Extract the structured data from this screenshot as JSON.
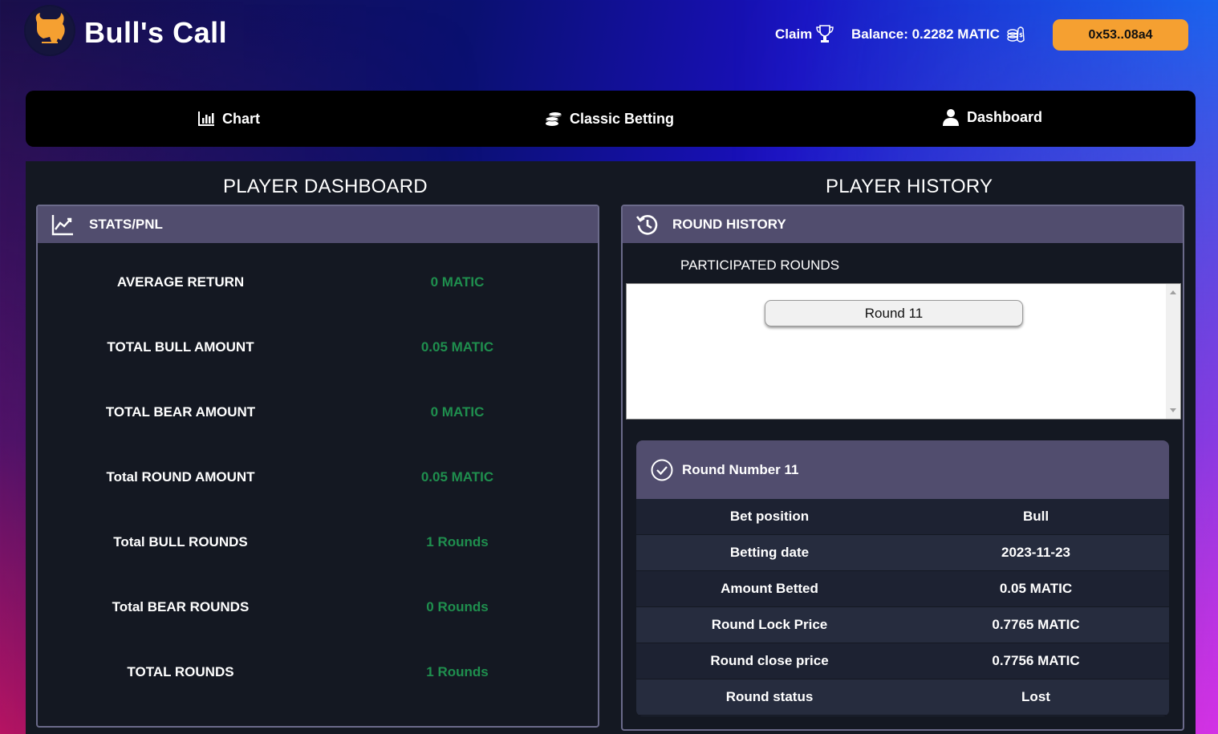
{
  "app": {
    "title": "Bull's Call",
    "logo_text": "BULLSCALL"
  },
  "header": {
    "claim_label": "Claim",
    "balance_label": "Balance: 0.2282 MATIC",
    "wallet_address": "0x53..08a4"
  },
  "nav": {
    "items": [
      {
        "label": "Chart",
        "icon": "bar-chart-icon"
      },
      {
        "label": "Classic Betting",
        "icon": "coins-stack-icon"
      },
      {
        "label": "Dashboard",
        "icon": "user-icon"
      }
    ]
  },
  "dashboard": {
    "title": "PLAYER DASHBOARD",
    "card_title": "STATS/PNL",
    "stats": [
      {
        "label": "AVERAGE RETURN",
        "value": "0 MATIC"
      },
      {
        "label": "TOTAL BULL AMOUNT",
        "value": "0.05 MATIC"
      },
      {
        "label": "TOTAL BEAR AMOUNT",
        "value": "0 MATIC"
      },
      {
        "label": "Total ROUND AMOUNT",
        "value": "0.05 MATIC"
      },
      {
        "label": "Total BULL ROUNDS",
        "value": "1 Rounds"
      },
      {
        "label": "Total BEAR ROUNDS",
        "value": "0 Rounds"
      },
      {
        "label": "TOTAL ROUNDS",
        "value": "1 Rounds"
      }
    ]
  },
  "history": {
    "title": "PLAYER HISTORY",
    "card_title": "ROUND HISTORY",
    "participated_label": "PARTICIPATED ROUNDS",
    "rounds": [
      "Round 11"
    ],
    "detail": {
      "title": "Round Number 11",
      "rows": [
        {
          "label": "Bet position",
          "value": "Bull"
        },
        {
          "label": "Betting date",
          "value": "2023-11-23"
        },
        {
          "label": "Amount Betted",
          "value": "0.05 MATIC"
        },
        {
          "label": "Round Lock Price",
          "value": "0.7765 MATIC"
        },
        {
          "label": "Round close price",
          "value": "0.7756 MATIC"
        },
        {
          "label": "Round status",
          "value": "Lost"
        }
      ]
    }
  },
  "colors": {
    "accent": "#f5a031",
    "positive": "#1f8f4e",
    "card_header": "#514d6e",
    "panel_bg": "#141822"
  }
}
